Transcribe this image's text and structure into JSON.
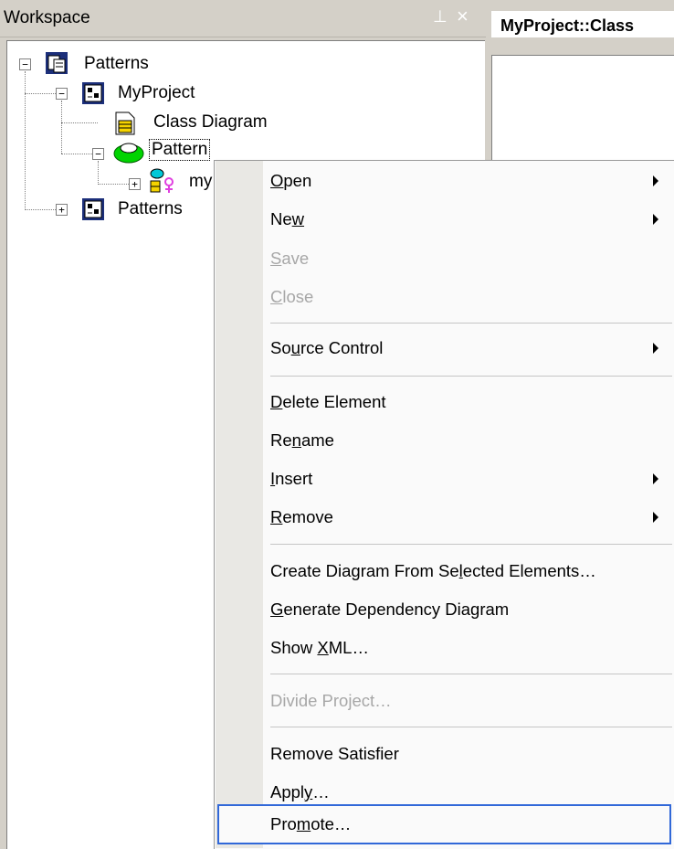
{
  "workspace": {
    "title": "Workspace",
    "pin_glyph": "⊥",
    "close_glyph": "×",
    "tree": [
      {
        "label": "Patterns",
        "icon": "workspace-icon",
        "level": 0,
        "expanded": true
      },
      {
        "label": "MyProject",
        "icon": "project-icon",
        "level": 1,
        "expanded": true
      },
      {
        "label": "Class Diagram",
        "icon": "class-diagram-icon",
        "level": 2
      },
      {
        "label": "Pattern",
        "icon": "pattern-icon",
        "level": 2,
        "expanded": true,
        "selected": true
      },
      {
        "label": "my",
        "icon": "role-icon",
        "level": 3,
        "expanded": false
      },
      {
        "label": "Patterns",
        "icon": "project-icon",
        "level": 1,
        "expanded": false
      }
    ]
  },
  "editor": {
    "tab_label": "MyProject::Class"
  },
  "context_menu": {
    "items": [
      {
        "pre": "",
        "u": "O",
        "post": "pen",
        "submenu": true,
        "enabled": true
      },
      {
        "pre": "Ne",
        "u": "w",
        "post": "",
        "submenu": true,
        "enabled": true
      },
      {
        "pre": "",
        "u": "S",
        "post": "ave",
        "submenu": false,
        "enabled": false
      },
      {
        "pre": "",
        "u": "C",
        "post": "lose",
        "submenu": false,
        "enabled": false
      },
      {
        "pre": "So",
        "u": "u",
        "post": "rce Control",
        "submenu": true,
        "enabled": true
      },
      {
        "pre": "",
        "u": "D",
        "post": "elete Element",
        "submenu": false,
        "enabled": true
      },
      {
        "pre": "Re",
        "u": "n",
        "post": "ame",
        "submenu": false,
        "enabled": true
      },
      {
        "pre": "",
        "u": "I",
        "post": "nsert",
        "submenu": true,
        "enabled": true
      },
      {
        "pre": "",
        "u": "R",
        "post": "emove",
        "submenu": true,
        "enabled": true
      },
      {
        "pre": "Create Diagram From Se",
        "u": "l",
        "post": "ected Elements…",
        "submenu": false,
        "enabled": true
      },
      {
        "pre": "",
        "u": "G",
        "post": "enerate Dependency Diagram",
        "submenu": false,
        "enabled": true
      },
      {
        "pre": "Show ",
        "u": "X",
        "post": "ML…",
        "submenu": false,
        "enabled": true
      },
      {
        "pre": "Divide Project…",
        "u": "",
        "post": "",
        "submenu": false,
        "enabled": false
      },
      {
        "pre": "Remove Satisfier",
        "u": "",
        "post": "",
        "submenu": false,
        "enabled": true
      },
      {
        "pre": "Appl",
        "u": "y",
        "post": "…",
        "submenu": false,
        "enabled": true
      },
      {
        "pre": "Pro",
        "u": "m",
        "post": "ote…",
        "submenu": false,
        "enabled": true,
        "highlighted": true
      }
    ]
  },
  "colors": {
    "chrome": "#d4d0c8",
    "menu_bg": "#fafafa",
    "gutter": "#e9e8e4",
    "highlight_border": "#3168d8",
    "disabled_text": "#a7a7a7"
  }
}
